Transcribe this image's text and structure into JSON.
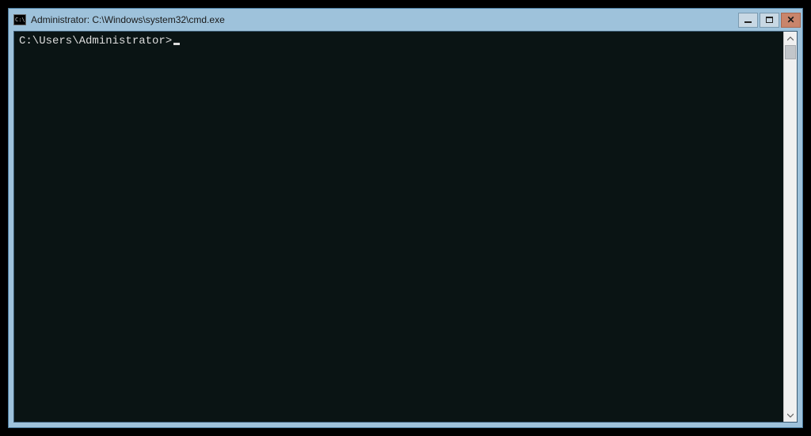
{
  "window": {
    "title": "Administrator: C:\\Windows\\system32\\cmd.exe",
    "icon_text": "C:\\"
  },
  "console": {
    "prompt": "C:\\Users\\Administrator>"
  },
  "colors": {
    "titlebar": "#9ec2db",
    "console_bg": "#0a1414",
    "console_fg": "#dcdcdc",
    "close_btn": "#c9856b"
  }
}
